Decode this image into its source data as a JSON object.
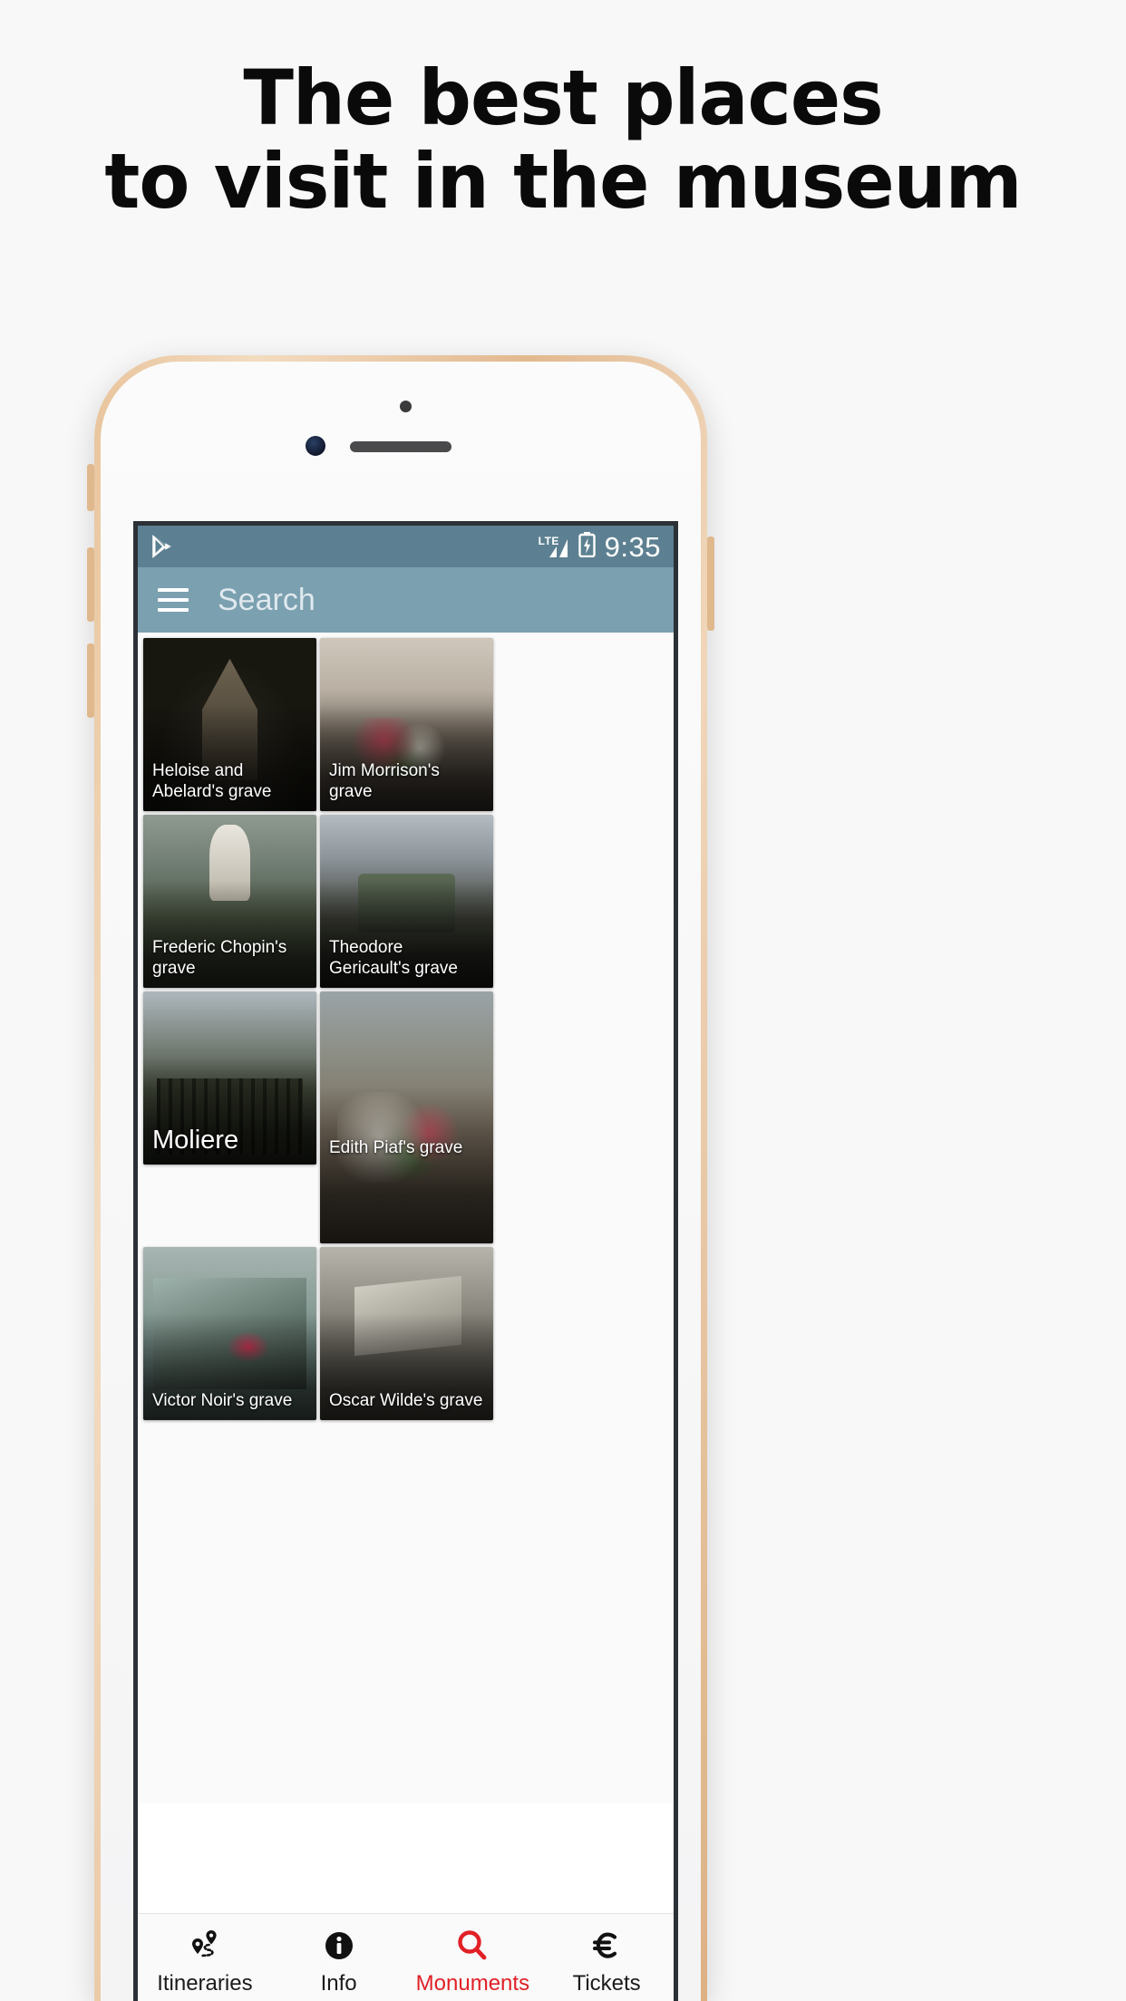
{
  "headline": {
    "line1": "The best places",
    "line2": "to visit in the museum"
  },
  "phone": {
    "status_bar": {
      "notification_icon": "play-store-icon",
      "network": "LTE",
      "signal_icon": "signal-bars-icon",
      "battery_icon": "battery-charging-icon",
      "time": "9:35"
    },
    "app_bar": {
      "menu_icon": "hamburger-menu-icon",
      "search_placeholder": "Search",
      "search_value": ""
    },
    "grid": {
      "tiles": [
        {
          "label": "Heloise and Abelard's grave",
          "size": "small",
          "art": "p1"
        },
        {
          "label": "Jim Morrison's grave",
          "size": "small",
          "art": "p2"
        },
        {
          "label": "Frederic Chopin's grave",
          "size": "small",
          "art": "p3"
        },
        {
          "label": "Theodore Gericault's grave",
          "size": "small",
          "art": "p4"
        },
        {
          "label": "Moliere",
          "size": "large",
          "art": "p5"
        },
        {
          "label": "Edith Piaf's grave",
          "size": "tall",
          "art": "p6"
        },
        {
          "label": "Victor Noir's grave",
          "size": "small",
          "art": "p7"
        },
        {
          "label": "Oscar Wilde's grave",
          "size": "small",
          "art": "p8"
        }
      ]
    },
    "bottom_nav": {
      "active_color": "#e12026",
      "inactive_color": "#1a1a1a",
      "items": [
        {
          "label": "Itineraries",
          "icon": "route-pins-icon",
          "active": false
        },
        {
          "label": "Info",
          "icon": "info-circle-icon",
          "active": false
        },
        {
          "label": "Monuments",
          "icon": "search-magnifier-icon",
          "active": true
        },
        {
          "label": "Tickets",
          "icon": "euro-icon",
          "active": false
        }
      ]
    }
  },
  "colors": {
    "page_bg": "#f8f8f8",
    "status_bar": "#5c8091",
    "app_bar": "#7ba0b0",
    "accent_red": "#e12026"
  }
}
